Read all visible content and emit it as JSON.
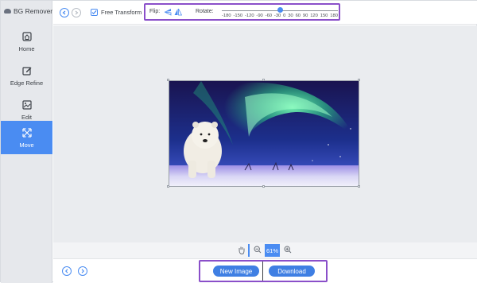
{
  "app": {
    "name": "BG Remover"
  },
  "sidebar": {
    "items": [
      {
        "label": "Home",
        "icon": "home-icon"
      },
      {
        "label": "Edge Refine",
        "icon": "edit-square-icon"
      },
      {
        "label": "Edit",
        "icon": "image-edit-icon"
      },
      {
        "label": "Move",
        "icon": "move-arrows-icon",
        "active": true
      }
    ]
  },
  "toolbar": {
    "undo_icon": "undo-icon",
    "redo_icon": "redo-icon",
    "free_transform_label": "Free Transform",
    "free_transform_checked": true,
    "flip_label": "Flip:",
    "rotate_label": "Rotate:",
    "rotate_ticks": [
      "-180",
      "-150",
      "-120",
      "-90",
      "-60",
      "-30",
      "0",
      "30",
      "60",
      "90",
      "120",
      "150",
      "180"
    ],
    "rotate_value": 0
  },
  "zoom": {
    "value": "61%"
  },
  "footer": {
    "new_image_label": "New Image",
    "download_label": "Download"
  },
  "colors": {
    "accent": "#4a8cf2",
    "highlight": "#8a4fc9",
    "sidebar_bg": "#e6e8ec"
  }
}
